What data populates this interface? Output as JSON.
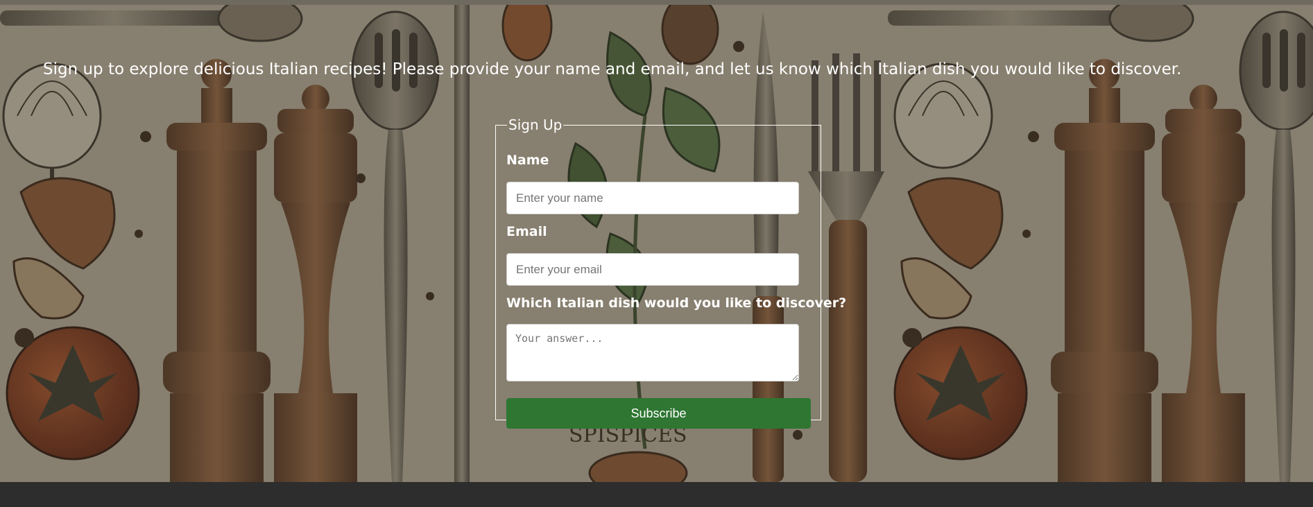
{
  "intro_text": "Sign up to explore delicious Italian recipes! Please provide your name and email, and let us know which Italian dish you would like to discover.",
  "form": {
    "legend": "Sign Up",
    "name_label": "Name",
    "name_placeholder": "Enter your name",
    "name_value": "",
    "email_label": "Email",
    "email_placeholder": "Enter your email",
    "email_value": "",
    "dish_label": "Which Italian dish would you like to discover?",
    "dish_placeholder": "Your answer...",
    "dish_value": "",
    "submit_label": "Subscribe"
  },
  "background": {
    "description_visible_text": "SPISPICES",
    "icons": [
      "onion-icon",
      "pepper-mill-icon",
      "tomato-icon",
      "garlic-icon",
      "spoon-icon",
      "fork-icon",
      "slotted-spoon-icon",
      "basil-leaf-icon",
      "knife-icon"
    ]
  },
  "colors": {
    "submit_button": "#2e7632",
    "text": "#ffffff",
    "footer_band": "#2d2d2d"
  }
}
